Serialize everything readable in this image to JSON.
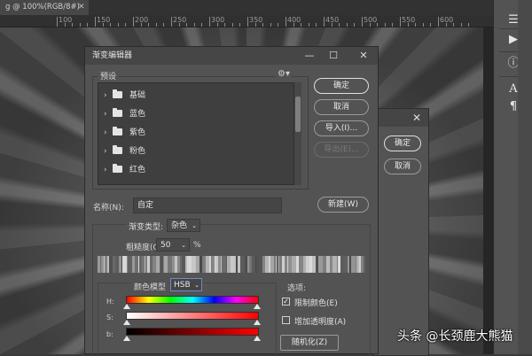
{
  "app": {
    "doc_tab": "g @ 100%(RGB/8#)",
    "ruler_labels": [
      "100",
      "150",
      "200",
      "250",
      "300",
      "350",
      "400",
      "450",
      "500",
      "550",
      "600"
    ]
  },
  "right_panel": {
    "icons": [
      "play-icon",
      "info-icon",
      "text-icon",
      "paragraph-icon"
    ]
  },
  "dialog": {
    "title": "渐变编辑器",
    "presets": {
      "label": "预设",
      "folders": [
        "基础",
        "蓝色",
        "紫色",
        "粉色",
        "红色"
      ]
    },
    "buttons": {
      "ok": "确定",
      "cancel": "取消",
      "import": "导入(I)...",
      "export": "导出(E)...",
      "new": "新建(W)"
    },
    "name": {
      "label": "名称(N):",
      "value": "自定"
    },
    "gradient_type": {
      "label": "渐变类型:",
      "value": "杂色"
    },
    "roughness": {
      "label": "粗糙度(G):",
      "value": "50",
      "unit": "%"
    },
    "color_model": {
      "label": "颜色模型",
      "value": "HSB",
      "channels": [
        "H:",
        "S:",
        "b:"
      ]
    },
    "options": {
      "label": "选项:",
      "restrict_colors": {
        "label": "限制颜色(E)",
        "checked": true
      },
      "add_transparency": {
        "label": "增加透明度(A)",
        "checked": false
      },
      "randomize": "随机化(Z)"
    }
  },
  "secondary_dialog": {
    "ok": "确定",
    "cancel": "取消"
  },
  "watermark": "头条 @长颈鹿大熊猫",
  "colors": {
    "dialog_bg": "#535353",
    "title_bar": "#464646",
    "list_bg": "#3f3f3f"
  }
}
